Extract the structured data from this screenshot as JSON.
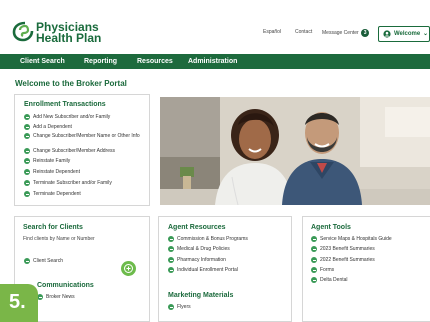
{
  "header": {
    "logo_line1": "Physicians",
    "logo_line2": "Health Plan",
    "espanol": "Español",
    "contact": "Contact",
    "message_center": "Message Center",
    "message_count": "3",
    "welcome": "Welcome"
  },
  "nav": {
    "items": [
      "Client Search",
      "Reporting",
      "Resources",
      "Administration"
    ]
  },
  "page_title": "Welcome to the Broker Portal",
  "enrollment": {
    "title": "Enrollment Transactions",
    "items": [
      "Add New Subscriber and/or Family",
      "Add a Dependent",
      "Change Subscriber/Member Name or Other Info",
      "Change Subscriber/Member Address",
      "Reinstate Family",
      "Reinstate Dependent",
      "Terminate Subscriber and/or Family",
      "Terminate Dependent"
    ]
  },
  "search": {
    "title": "Search for Clients",
    "subtitle": "Find clients by Name or Number",
    "link": "Client Search"
  },
  "communications": {
    "title": "Communications",
    "link": "Broker News"
  },
  "agent_resources": {
    "title": "Agent Resources",
    "items": [
      "Commission & Bonus Programs",
      "Medical & Drug Policies",
      "Pharmacy Information",
      "Individual Enrollment Portal"
    ]
  },
  "marketing": {
    "title": "Marketing Materials",
    "items": [
      "Flyers"
    ]
  },
  "agent_tools": {
    "title": "Agent Tools",
    "items": [
      "Service Maps & Hospitals Guide",
      "2023 Benefit Summaries",
      "2022 Benefit Summaries",
      "Forms",
      "Delta Dental"
    ]
  },
  "step_badge": "5.",
  "colors": {
    "brand_green": "#1d6a3d",
    "accent_green": "#3a9a57",
    "badge_green": "#7ab648"
  }
}
